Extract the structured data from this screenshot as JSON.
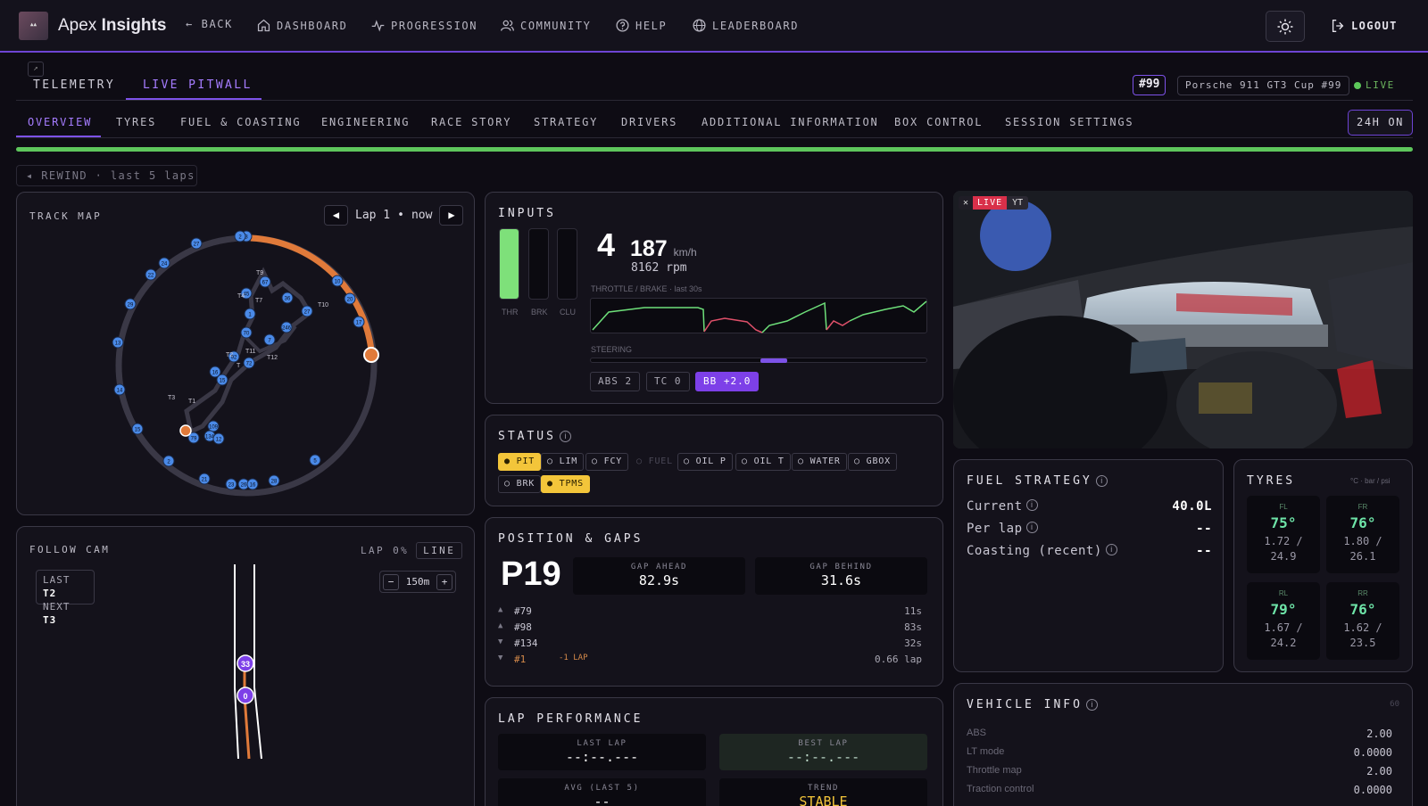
{
  "app": {
    "name_light": "Apex",
    "name_bold": "Insights"
  },
  "nav": {
    "back": "← BACK",
    "items": [
      "DASHBOARD",
      "PROGRESSION",
      "COMMUNITY",
      "HELP",
      "LEADERBOARD"
    ],
    "logout": "LOGOUT"
  },
  "view_tabs": [
    "TELEMETRY",
    "LIVE PITWALL"
  ],
  "car": {
    "number": "#99",
    "name": "Porsche 911 GT3 Cup #99",
    "live": "LIVE"
  },
  "section_tabs": [
    "OVERVIEW",
    "TYRES",
    "FUEL & COASTING",
    "ENGINEERING",
    "RACE STORY",
    "STRATEGY",
    "DRIVERS",
    "ADDITIONAL INFORMATION",
    "BOX CONTROL",
    "SESSION SETTINGS"
  ],
  "btn_24h": "24H ON",
  "rewind": "◂ REWIND · last 5 laps",
  "track_map": {
    "title": "TRACK MAP",
    "prev": "◀",
    "lap": "Lap 1",
    "sep": "•",
    "now": "now",
    "next": "▶",
    "turn_labels": [
      "T9",
      "T4",
      "T7",
      "T10",
      "T12",
      "T2",
      "T11",
      "T3",
      "T1",
      "T"
    ],
    "markers": [
      "3",
      "27",
      "24",
      "22",
      "29",
      "13",
      "14",
      "15",
      "2",
      "21",
      "23",
      "26",
      "16",
      "28",
      "5",
      "17",
      "20",
      "10",
      "45",
      "67",
      "1",
      "36",
      "27",
      "70",
      "246",
      "7",
      "92",
      "72",
      "16",
      "15",
      "109",
      "79",
      "134",
      "12",
      "2"
    ]
  },
  "follow_cam": {
    "title": "FOLLOW CAM",
    "lap_pct": "LAP 0%",
    "line_btn": "LINE",
    "last_label": "LAST",
    "last_val": "T2",
    "next_label": "NEXT",
    "next_val": "T3",
    "zoom_minus": "−",
    "zoom_val": "150m",
    "zoom_plus": "+",
    "cars": [
      "33",
      "0"
    ]
  },
  "inputs": {
    "title": "INPUTS",
    "bars": [
      {
        "label": "THR",
        "fill": 1.0
      },
      {
        "label": "BRK",
        "fill": 0
      },
      {
        "label": "CLU",
        "fill": 0
      }
    ],
    "gear": "4",
    "speed": "187",
    "speed_unit": "km/h",
    "rpm": "8162 rpm",
    "trace_label": "THROTTLE / BRAKE · last 30s",
    "steering_label": "STEERING",
    "aids": [
      "ABS 2",
      "TC 0",
      "BB +2.0"
    ]
  },
  "status": {
    "title": "STATUS",
    "chips": [
      {
        "label": "● PIT",
        "state": "warn"
      },
      {
        "label": "○ LIM",
        "state": "off"
      },
      {
        "label": "○ FCY",
        "state": "off"
      },
      {
        "label": "○ FUEL",
        "state": "dim"
      },
      {
        "label": "○ OIL P",
        "state": "off"
      },
      {
        "label": "○ OIL T",
        "state": "off"
      },
      {
        "label": "○ WATER",
        "state": "off"
      },
      {
        "label": "○ GBOX",
        "state": "off"
      },
      {
        "label": "○ BRK",
        "state": "off"
      },
      {
        "label": "● TPMS",
        "state": "warn"
      }
    ]
  },
  "position": {
    "title": "POSITION & GAPS",
    "pos": "P19",
    "gap_ahead_label": "GAP AHEAD",
    "gap_ahead": "82.9s",
    "gap_behind_label": "GAP BEHIND",
    "gap_behind": "31.6s",
    "rows": [
      {
        "arrow": "▲",
        "car": "#79",
        "note": "",
        "gap": "11s"
      },
      {
        "arrow": "▲",
        "car": "#98",
        "note": "",
        "gap": "83s"
      },
      {
        "arrow": "▼",
        "car": "#134",
        "note": "",
        "gap": "32s"
      },
      {
        "arrow": "▼",
        "car": "#1",
        "note": "-1 LAP",
        "gap": "0.66 lap"
      }
    ]
  },
  "lap_perf": {
    "title": "LAP PERFORMANCE",
    "last_label": "LAST LAP",
    "last_val": "--:--.---",
    "best_label": "BEST LAP",
    "best_val": "--:--.---",
    "avg_label": "AVG (LAST 5)",
    "avg_val": "--",
    "trend_label": "TREND",
    "trend_val": "STABLE"
  },
  "video": {
    "close": "✕",
    "live": "LIVE",
    "yt": "YT"
  },
  "fuel": {
    "title": "FUEL STRATEGY",
    "rows": [
      {
        "label": "Current",
        "value": "40.0L"
      },
      {
        "label": "Per lap",
        "value": "--"
      },
      {
        "label": "Coasting (recent)",
        "value": "--"
      }
    ]
  },
  "tyres": {
    "title": "TYRES",
    "unit": "°C · bar / psi",
    "items": [
      {
        "pos": "FL",
        "temp": "75°",
        "p1": "1.72 /",
        "p2": "24.9"
      },
      {
        "pos": "FR",
        "temp": "76°",
        "p1": "1.80 /",
        "p2": "26.1"
      },
      {
        "pos": "RL",
        "temp": "79°",
        "p1": "1.67 /",
        "p2": "24.2"
      },
      {
        "pos": "RR",
        "temp": "76°",
        "p1": "1.62 /",
        "p2": "23.5"
      }
    ]
  },
  "vehicle": {
    "title": "VEHICLE INFO",
    "count": "60",
    "rows": [
      {
        "label": "ABS",
        "value": "2.00"
      },
      {
        "label": "LT mode",
        "value": "0.0000"
      },
      {
        "label": "Throttle map",
        "value": "2.00"
      },
      {
        "label": "Traction control",
        "value": "0.0000"
      }
    ]
  },
  "colors": {
    "accent": "#7d52e8",
    "green": "#5ec65c",
    "orange": "#e07a3a",
    "marker": "#4a8ae8",
    "warn": "#f3c53a"
  }
}
